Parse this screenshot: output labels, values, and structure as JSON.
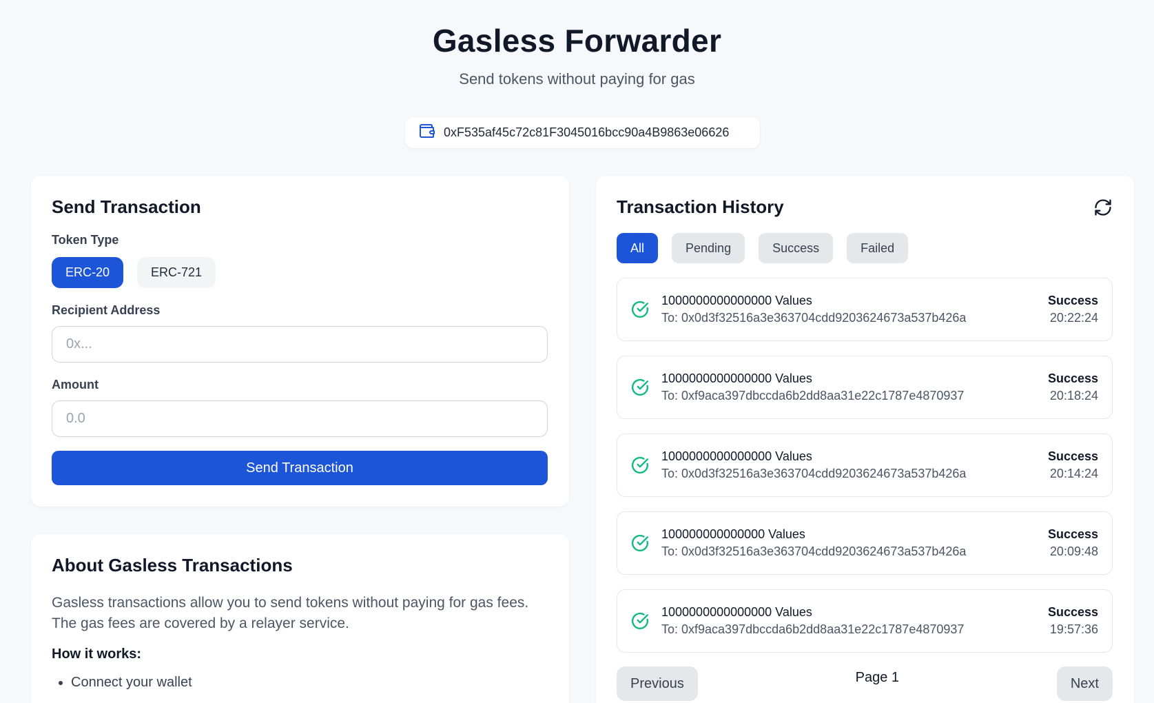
{
  "header": {
    "title": "Gasless Forwarder",
    "subtitle": "Send tokens without paying for gas"
  },
  "wallet": {
    "address": "0xF535af45c72c81F3045016bcc90a4B9863e06626",
    "icon": "wallet-icon"
  },
  "send": {
    "title": "Send Transaction",
    "token_type_label": "Token Type",
    "token_types": [
      "ERC-20",
      "ERC-721"
    ],
    "selected_token_type": "ERC-20",
    "recipient_label": "Recipient Address",
    "recipient_placeholder": "0x...",
    "recipient_value": "",
    "amount_label": "Amount",
    "amount_placeholder": "0.0",
    "amount_value": "",
    "submit_label": "Send Transaction"
  },
  "about": {
    "title": "About Gasless Transactions",
    "description": "Gasless transactions allow you to send tokens without paying for gas fees. The gas fees are covered by a relayer service.",
    "how_title": "How it works:",
    "steps": [
      "Connect your wallet"
    ]
  },
  "history": {
    "title": "Transaction History",
    "refresh_icon": "refresh-icon",
    "filters": [
      "All",
      "Pending",
      "Success",
      "Failed"
    ],
    "active_filter": "All",
    "transactions": [
      {
        "amount": "1000000000000000 Values",
        "to": "To: 0x0d3f32516a3e363704cdd9203624673a537b426a",
        "status": "Success",
        "time": "20:22:24"
      },
      {
        "amount": "1000000000000000 Values",
        "to": "To: 0xf9aca397dbccda6b2dd8aa31e22c1787e4870937",
        "status": "Success",
        "time": "20:18:24"
      },
      {
        "amount": "1000000000000000 Values",
        "to": "To: 0x0d3f32516a3e363704cdd9203624673a537b426a",
        "status": "Success",
        "time": "20:14:24"
      },
      {
        "amount": "100000000000000 Values",
        "to": "To: 0x0d3f32516a3e363704cdd9203624673a537b426a",
        "status": "Success",
        "time": "20:09:48"
      },
      {
        "amount": "1000000000000000 Values",
        "to": "To: 0xf9aca397dbccda6b2dd8aa31e22c1787e4870937",
        "status": "Success",
        "time": "19:57:36"
      }
    ],
    "prev_label": "Previous",
    "page_label": "Page 1",
    "next_label": "Next"
  },
  "colors": {
    "primary": "#1d55d8",
    "success": "#10b981",
    "background": "#f6f8fb"
  }
}
